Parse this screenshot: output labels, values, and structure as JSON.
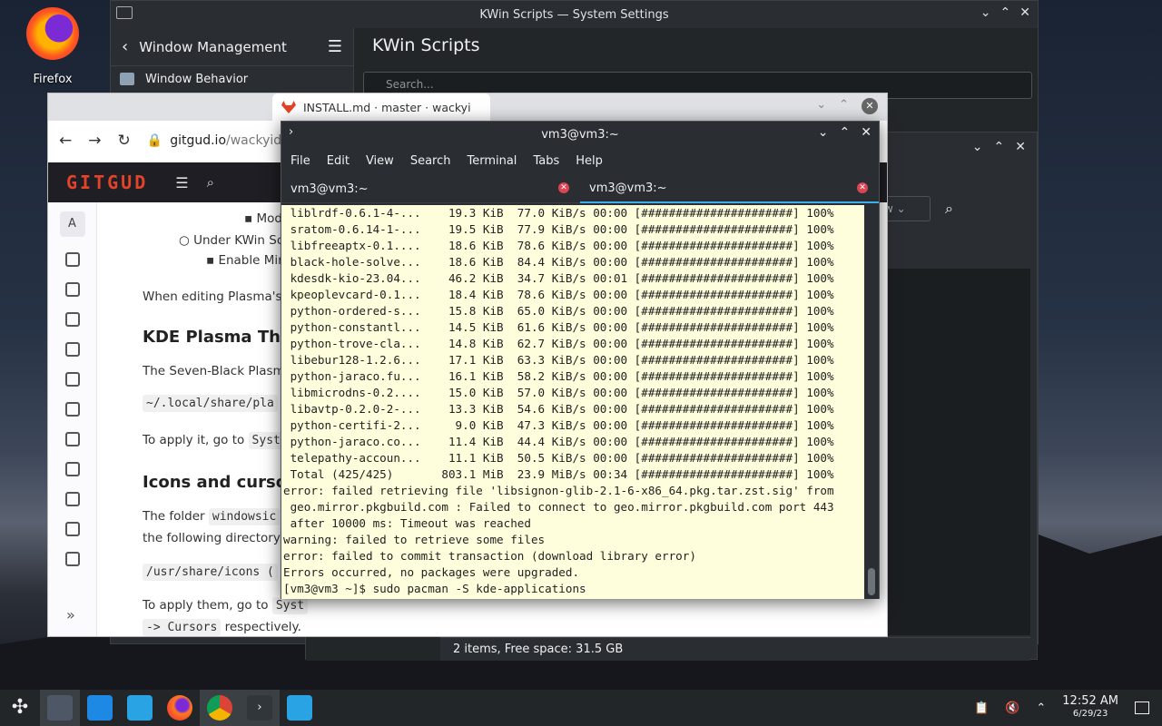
{
  "desktop": {
    "icon_label": "Firefox"
  },
  "settings": {
    "title": "KWin Scripts — System Settings",
    "sidebar_header": "Window Management",
    "sidebar_item": "Window Behavior",
    "page_title": "KWin Scripts",
    "search_placeholder": "Search..."
  },
  "filemanager": {
    "sort_value": "w",
    "status": "2 items, Free space: 31.5 GB"
  },
  "browser": {
    "tab_title": "INSTALL.md · master · wackyi",
    "url_host": "gitgud.io",
    "url_path": "/wackyid",
    "site_logo": "GITGUD",
    "avatar_letter": "A",
    "lines": {
      "l1": "Modify",
      "l2": "Under KWin Sc",
      "l3": "Enable Mir",
      "l4": "When editing Plasma's",
      "h1": "KDE Plasma Ther",
      "l5": "The Seven-Black Plasma",
      "c1": "~/.local/share/pla",
      "l6a": "To apply it, go to",
      "c2": "Syste",
      "h2": "Icons and cursor",
      "l7a": "The folder",
      "c3": "windowsic",
      "l8": "the following directory:",
      "c4": "/usr/share/icons (",
      "l9a": "To apply them, go to",
      "c5": "Syst",
      "c6": "-> Cursors",
      "l10": "respectively."
    }
  },
  "terminal": {
    "title": "vm3@vm3:~",
    "menu": [
      "File",
      "Edit",
      "View",
      "Search",
      "Terminal",
      "Tabs",
      "Help"
    ],
    "tabs": [
      "vm3@vm3:~",
      "vm3@vm3:~"
    ],
    "lines": [
      " liblrdf-0.6.1-4-...    19.3 KiB  77.0 KiB/s 00:00 [######################] 100%",
      " sratom-0.6.14-1-...    19.5 KiB  77.9 KiB/s 00:00 [######################] 100%",
      " libfreeaptx-0.1....    18.6 KiB  78.6 KiB/s 00:00 [######################] 100%",
      " black-hole-solve...    18.6 KiB  84.4 KiB/s 00:00 [######################] 100%",
      " kdesdk-kio-23.04...    46.2 KiB  34.7 KiB/s 00:01 [######################] 100%",
      " kpeoplevcard-0.1...    18.4 KiB  78.6 KiB/s 00:00 [######################] 100%",
      " python-ordered-s...    15.8 KiB  65.0 KiB/s 00:00 [######################] 100%",
      " python-constantl...    14.5 KiB  61.6 KiB/s 00:00 [######################] 100%",
      " python-trove-cla...    14.8 KiB  62.7 KiB/s 00:00 [######################] 100%",
      " libebur128-1.2.6...    17.1 KiB  63.3 KiB/s 00:00 [######################] 100%",
      " python-jaraco.fu...    16.1 KiB  58.2 KiB/s 00:00 [######################] 100%",
      " libmicrodns-0.2....    15.0 KiB  57.0 KiB/s 00:00 [######################] 100%",
      " libavtp-0.2.0-2-...    13.3 KiB  54.6 KiB/s 00:00 [######################] 100%",
      " python-certifi-2...     9.0 KiB  47.3 KiB/s 00:00 [######################] 100%",
      " python-jaraco.co...    11.4 KiB  44.4 KiB/s 00:00 [######################] 100%",
      " telepathy-accoun...    11.1 KiB  50.5 KiB/s 00:00 [######################] 100%",
      " Total (425/425)       803.1 MiB  23.9 MiB/s 00:34 [######################] 100%",
      "error: failed retrieving file 'libsignon-glib-2.1-6-x86_64.pkg.tar.zst.sig' from",
      " geo.mirror.pkgbuild.com : Failed to connect to geo.mirror.pkgbuild.com port 443",
      " after 10000 ms: Timeout was reached",
      "warning: failed to retrieve some files",
      "error: failed to commit transaction (download library error)",
      "Errors occurred, no packages were upgraded.",
      "[vm3@vm3 ~]$ sudo pacman -S kde-applications"
    ]
  },
  "taskbar": {
    "time": "12:52 AM",
    "date": "6/29/23"
  }
}
